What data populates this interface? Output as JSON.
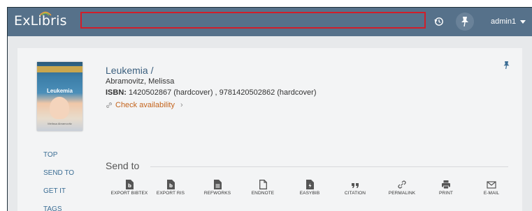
{
  "header": {
    "logo": "ExLibris",
    "search_value": "",
    "user": "admin1"
  },
  "record": {
    "cover_title": "Leukemia",
    "cover_author": "Melissa Abramovitz",
    "title": "Leukemia /",
    "author": "Abramovitz, Melissa",
    "isbn_label": "ISBN:",
    "isbn_value": "1420502867 (hardcover) , 9781420502862 (hardcover)",
    "availability": "Check availability"
  },
  "nav": {
    "items": [
      "TOP",
      "SEND TO",
      "GET IT",
      "TAGS"
    ]
  },
  "send_to": {
    "heading": "Send to",
    "actions": [
      {
        "label": "EXPORT BIBTEX",
        "icon": "document-b-icon"
      },
      {
        "label": "EXPORT RIS",
        "icon": "document-b-icon"
      },
      {
        "label": "REFWORKS",
        "icon": "document-lines-icon"
      },
      {
        "label": "ENDNOTE",
        "icon": "document-outline-icon"
      },
      {
        "label": "EASYBIB",
        "icon": "document-bolt-icon"
      },
      {
        "label": "CITATION",
        "icon": "quote-icon"
      },
      {
        "label": "PERMALINK",
        "icon": "link-icon"
      },
      {
        "label": "PRINT",
        "icon": "print-icon"
      },
      {
        "label": "E-MAIL",
        "icon": "email-icon"
      }
    ]
  },
  "colors": {
    "topbar": "#56718a",
    "search_border": "#d01e2a",
    "link": "#3b5f7e",
    "availability": "#c4641d",
    "background": "#e7e9eb",
    "card": "#f3f4f5"
  }
}
